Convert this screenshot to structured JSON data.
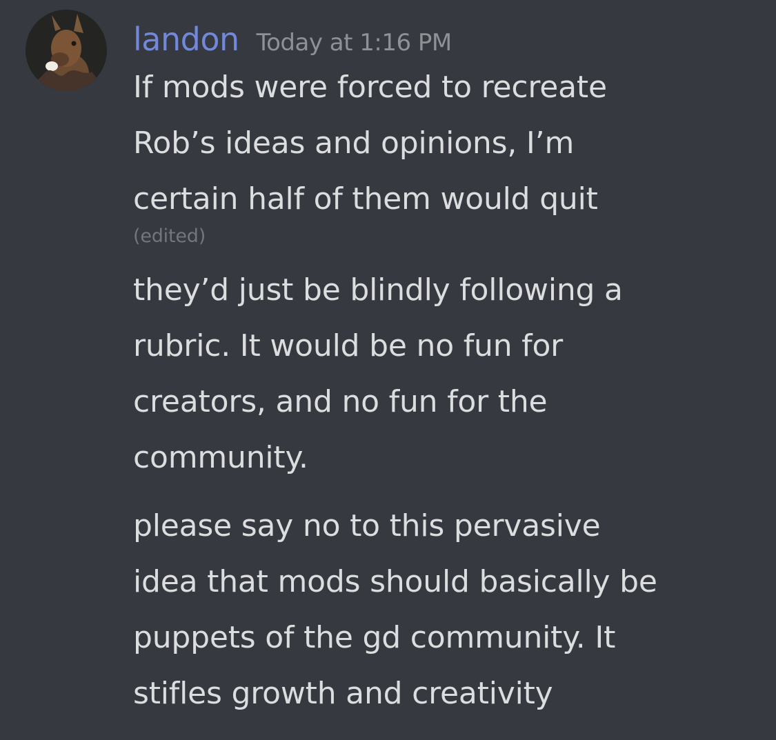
{
  "message": {
    "username": "landon",
    "timestamp": "Today at 1:16 PM",
    "avatar_icon": "avatar-icon",
    "paragraphs": [
      {
        "lines": [
          "If mods were forced to recreate",
          "Rob’s ideas and opinions, I’m",
          "certain half of them would quit"
        ],
        "edited": "(edited)"
      },
      {
        "lines": [
          "they’d just be blindly following a",
          "rubric. It would be no fun for",
          "creators, and no fun for the",
          "community."
        ]
      },
      {
        "lines": [
          "please say no to this pervasive",
          "idea that mods should basically be",
          "puppets of the gd community. It",
          "stifles growth and creativity"
        ]
      }
    ]
  },
  "colors": {
    "background": "#36393f",
    "username": "#7289da",
    "timestamp": "#8e9297",
    "text": "#dcddde",
    "edited": "#72767d"
  }
}
